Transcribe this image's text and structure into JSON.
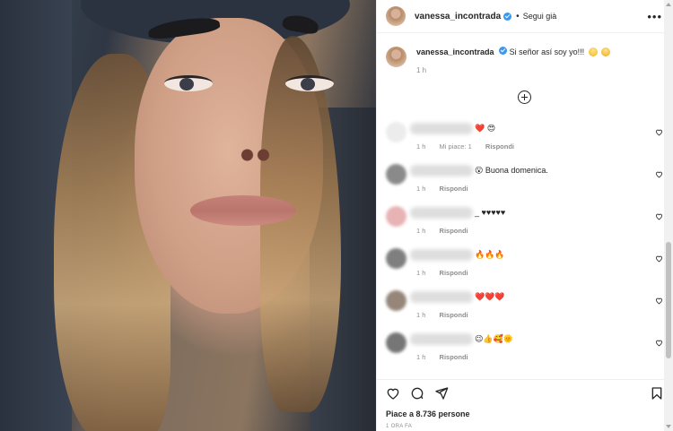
{
  "post": {
    "username": "vanessa_incontrada",
    "follow_label": "Segui già",
    "separator": "•",
    "more_label": "•••"
  },
  "caption": {
    "text": "Si señor así soy yo!!!",
    "time": "1 h"
  },
  "comments": [
    {
      "text": "❤️ 😍",
      "time": "1 h",
      "likes": "Mi piace: 1",
      "reply": "Rispondi",
      "avatar_color": "#ececec"
    },
    {
      "text": "😮 Buona domenica.",
      "time": "1 h",
      "likes": "",
      "reply": "Rispondi",
      "avatar_color": "#8a8a8a"
    },
    {
      "text": "_ ♥♥♥♥♥",
      "time": "1 h",
      "likes": "",
      "reply": "Rispondi",
      "avatar_color": "#e8b3b4"
    },
    {
      "text": "🔥🔥🔥",
      "time": "1 h",
      "likes": "",
      "reply": "Rispondi",
      "avatar_color": "#7f7f7f"
    },
    {
      "text": "❤️❤️❤️",
      "time": "1 h",
      "likes": "",
      "reply": "Rispondi",
      "avatar_color": "#958679"
    },
    {
      "text": "😉👍🥰🌞",
      "time": "1 h",
      "likes": "",
      "reply": "Rispondi",
      "avatar_color": "#767676"
    }
  ],
  "footer": {
    "likes_text": "Piace a 8.736 persone",
    "time_ago": "1 ORA FA"
  },
  "icons": {
    "like": "heart-icon",
    "comment": "comment-icon",
    "share": "share-icon",
    "save": "bookmark-icon",
    "add": "plus-circle-icon"
  },
  "colors": {
    "verified": "#3897f0",
    "text": "#262626",
    "muted": "#8e8e8e"
  }
}
